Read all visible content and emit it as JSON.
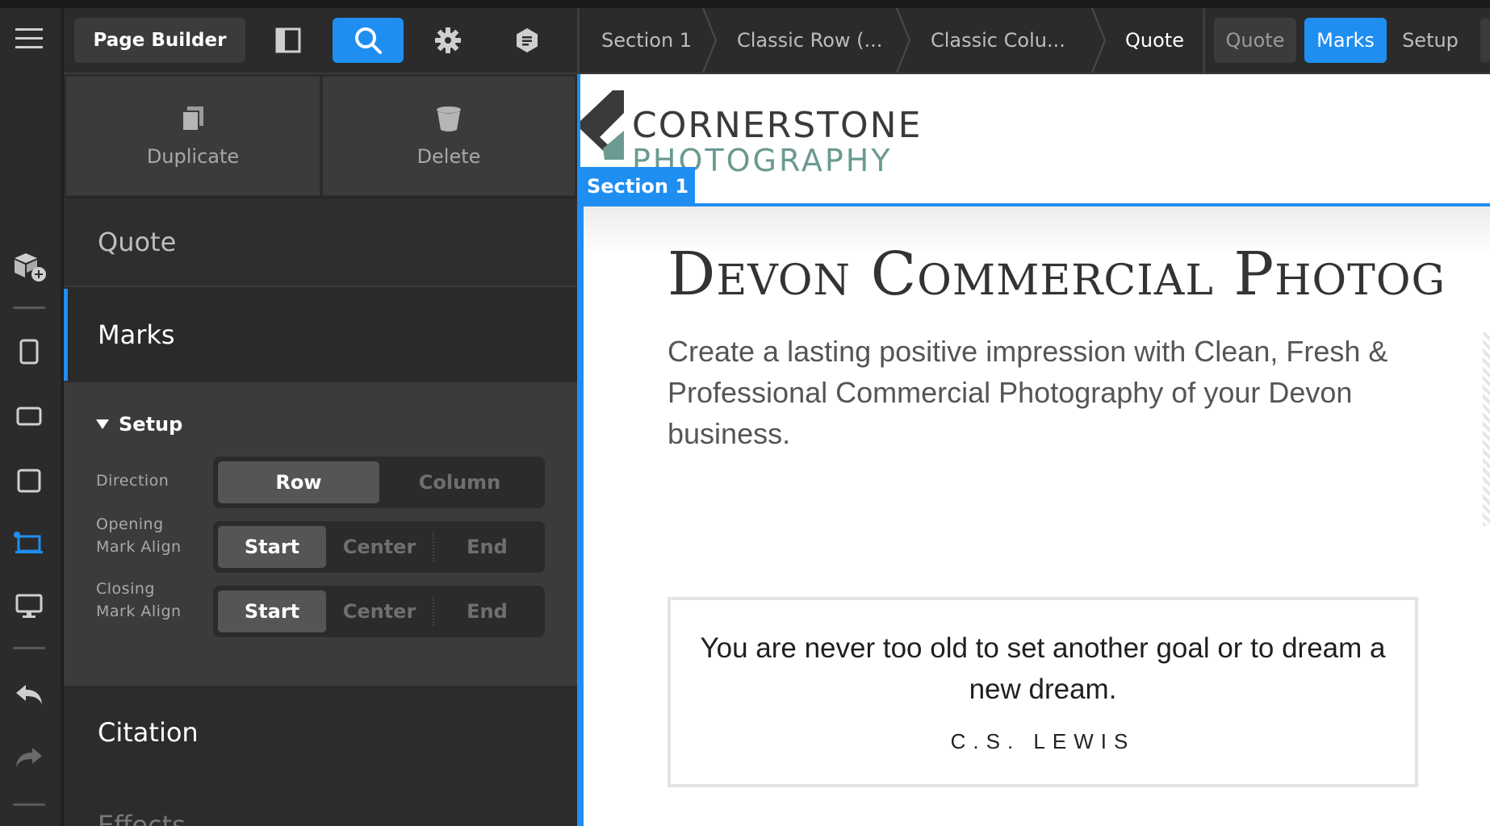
{
  "toolbar": {
    "page_builder_label": "Page Builder"
  },
  "breadcrumbs": [
    "Section 1",
    "Classic Row (...",
    "Classic Colu...",
    "Quote"
  ],
  "mode_tabs": [
    "Quote",
    "Marks",
    "Setup"
  ],
  "actions": {
    "duplicate": "Duplicate",
    "delete": "Delete"
  },
  "nav": {
    "quote": "Quote",
    "marks": "Marks",
    "citation": "Citation",
    "effects": "Effects"
  },
  "setup": {
    "title": "Setup",
    "direction": {
      "label": "Direction",
      "options": [
        "Row",
        "Column"
      ],
      "selected": "Row"
    },
    "opening": {
      "label_line1": "Opening",
      "label_line2": "Mark Align",
      "options": [
        "Start",
        "Center",
        "End"
      ],
      "selected": "Start"
    },
    "closing": {
      "label_line1": "Closing",
      "label_line2": "Mark Align",
      "options": [
        "Start",
        "Center",
        "End"
      ],
      "selected": "Start"
    }
  },
  "preview": {
    "logo_line1": "CORNERSTONE",
    "logo_line2": "PHOTOGRAPHY",
    "section_tag": "Section 1",
    "headline": "Devon Commercial Photog",
    "lede": "Create a lasting positive impression with Clean, Fresh & Professional Commercial Photography of your Devon business.",
    "quote": "You are never too old to set another goal or to dream a new dream.",
    "citation": "C.S. LEWIS"
  },
  "colors": {
    "accent": "#1f8ef1",
    "panel": "#2c2c2c",
    "logo_dark": "#3a3a3a",
    "logo_teal": "#6a9a92"
  }
}
